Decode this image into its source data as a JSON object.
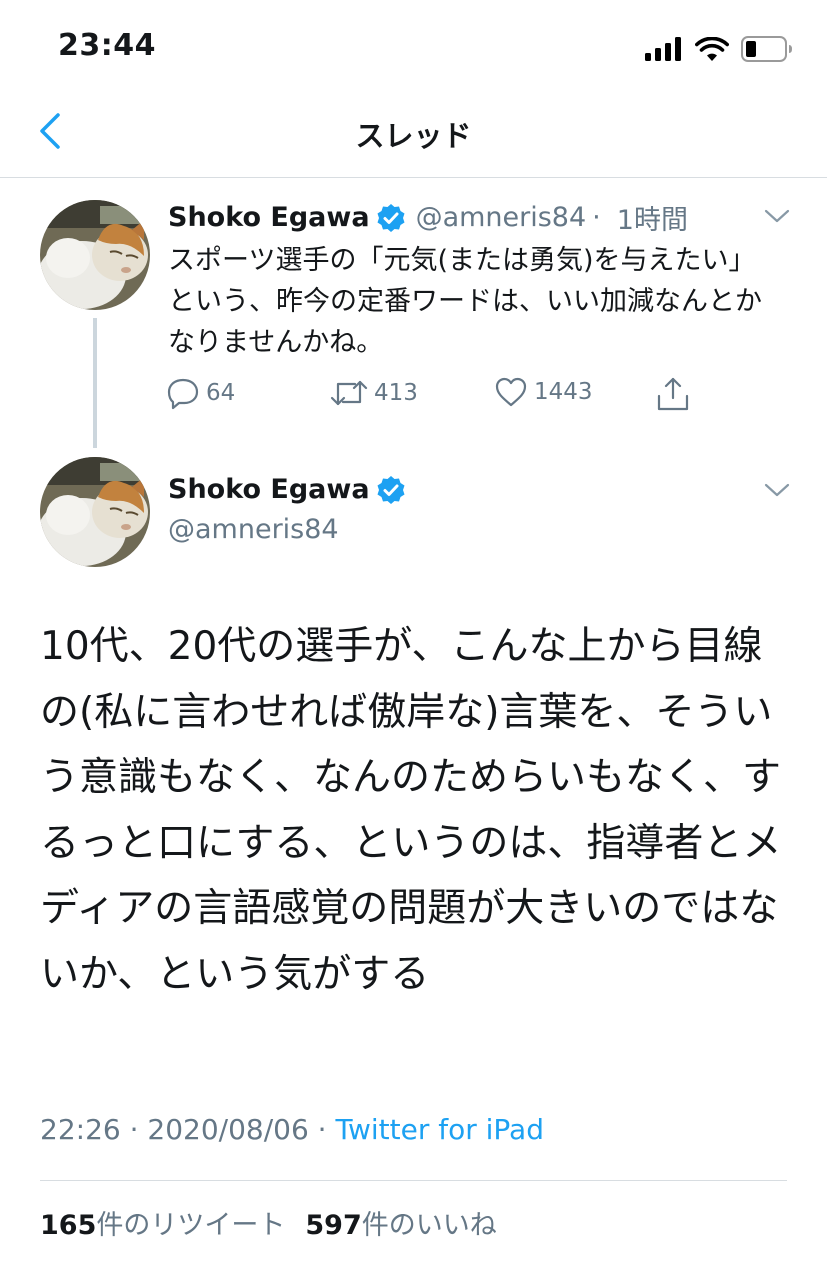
{
  "status_bar": {
    "time": "23:44"
  },
  "nav": {
    "title": "スレッド"
  },
  "tweet1": {
    "name": "Shoko Egawa",
    "handle": "@amneris84",
    "separator": "·",
    "time_ago": "1時間",
    "text": "スポーツ選手の「元気(または勇気)を与えたい」という、昨今の定番ワードは、いい加減なんとかなりませんかね。",
    "replies": "64",
    "retweets": "413",
    "likes": "1443"
  },
  "tweet2": {
    "name": "Shoko Egawa",
    "handle": "@amneris84",
    "text": "10代、20代の選手が、こんな上から目線の(私に言わせれば傲岸な)言葉を、そういう意識もなく、なんのためらいもなく、するっと口にする、というのは、指導者とメディアの言語感覚の問題が大きいのではないか、という気がする",
    "timestamp": "22:26 · 2020/08/06 · ",
    "source": "Twitter for iPad",
    "retweet_count": "165",
    "retweet_label": "件のリツイート",
    "like_count": "597",
    "like_label": "件のいいね"
  },
  "colors": {
    "accent": "#1da1f2",
    "muted": "#657786",
    "text": "#14171a"
  },
  "icons": [
    "back-chevron-icon",
    "verified-badge-icon",
    "caret-down-icon",
    "reply-icon",
    "retweet-icon",
    "like-heart-icon",
    "share-icon",
    "signal-icon",
    "wifi-icon",
    "battery-icon"
  ]
}
